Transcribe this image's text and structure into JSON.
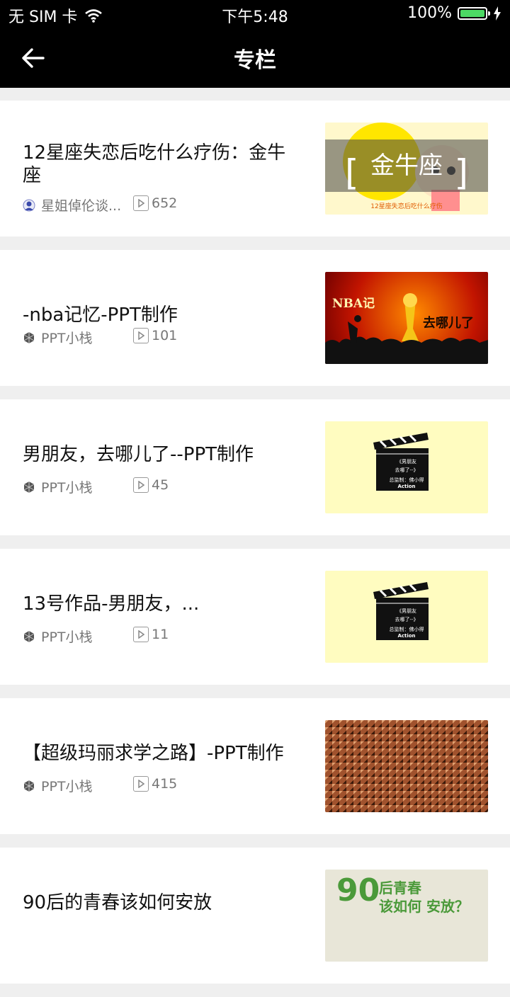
{
  "status": {
    "carrier": "无 SIM 卡",
    "time": "下午5:48",
    "battery": "100%",
    "battery_level": 1.0
  },
  "nav": {
    "title": "专栏"
  },
  "items": [
    {
      "title": "12星座失恋后吃什么疗伤：金牛座",
      "author": "星姐倬伦谈...",
      "plays": "652",
      "thumb": {
        "kind": "zodiac",
        "text": "金牛座",
        "sub": "12星座失恋后吃什么疗伤"
      }
    },
    {
      "title": "-nba记忆-PPT制作",
      "author": "PPT小栈",
      "plays": "101",
      "thumb": {
        "kind": "nba",
        "text": "NBA记",
        "text2": "去哪儿了"
      }
    },
    {
      "title": "男朋友，去哪儿了--PPT制作",
      "author": "PPT小栈",
      "plays": "45",
      "thumb": {
        "kind": "clapper",
        "line1": "《男朋友",
        "line2": "去哪了--》",
        "line3": "总监制：佛小得",
        "line4": "Action"
      }
    },
    {
      "title": "13号作品-男朋友，...",
      "author": "PPT小栈",
      "plays": "11",
      "thumb": {
        "kind": "clapper",
        "line1": "《男朋友",
        "line2": "去哪了--》",
        "line3": "总监制：佛小得",
        "line4": "Action"
      }
    },
    {
      "title": "【超级玛丽求学之路】-PPT制作",
      "author": "PPT小栈",
      "plays": "415",
      "thumb": {
        "kind": "bricks"
      }
    },
    {
      "title": "90后的青春该如何安放",
      "author": "",
      "plays": "",
      "thumb": {
        "kind": "retro",
        "text": "90",
        "text2": "后青春",
        "text3": "该如何 安放？"
      }
    }
  ]
}
